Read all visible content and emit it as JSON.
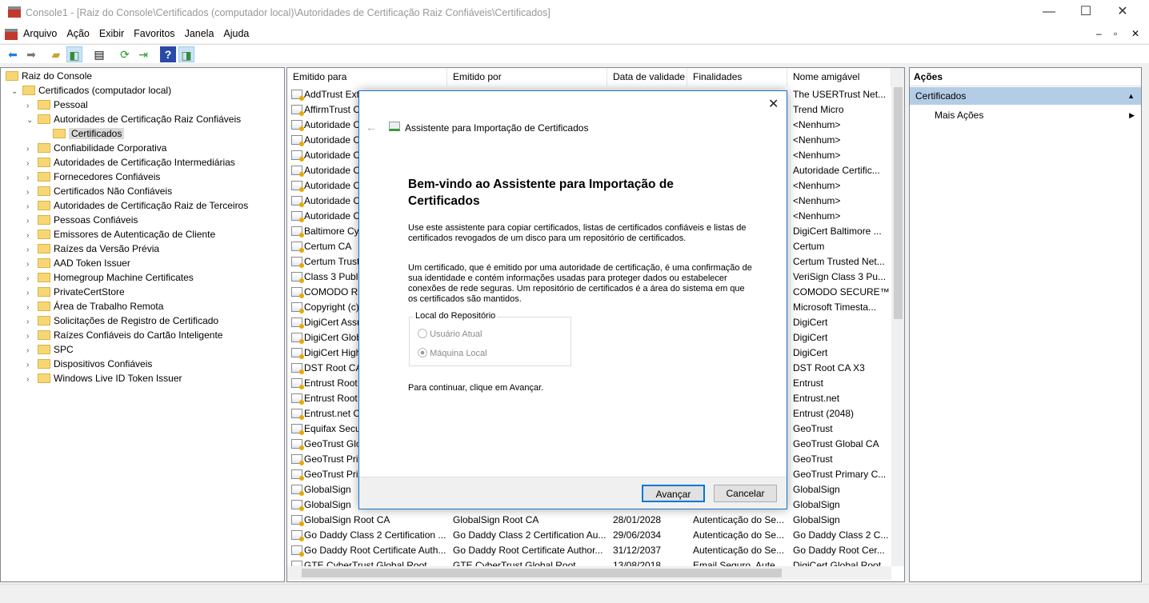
{
  "window": {
    "title": "Console1 - [Raiz do Console\\Certificados (computador local)\\Autoridades de Certificação Raiz Confiáveis\\Certificados]",
    "minimize": "—",
    "maximize": "☐",
    "close": "✕"
  },
  "menu": [
    "Arquivo",
    "Ação",
    "Exibir",
    "Favoritos",
    "Janela",
    "Ajuda"
  ],
  "mdi_controls": [
    "–",
    "▫",
    "✕"
  ],
  "tree": [
    {
      "label": "Raiz do Console",
      "level": 0,
      "chev": ""
    },
    {
      "label": "Certificados (computador local)",
      "level": 1,
      "chev": "⌄"
    },
    {
      "label": "Pessoal",
      "level": 2,
      "chev": "›"
    },
    {
      "label": "Autoridades de Certificação Raiz Confiáveis",
      "level": 2,
      "chev": "⌄"
    },
    {
      "label": "Certificados",
      "level": 3,
      "chev": "",
      "selected": true
    },
    {
      "label": "Confiabilidade Corporativa",
      "level": 2,
      "chev": "›"
    },
    {
      "label": "Autoridades de Certificação Intermediárias",
      "level": 2,
      "chev": "›"
    },
    {
      "label": "Fornecedores Confiáveis",
      "level": 2,
      "chev": "›"
    },
    {
      "label": "Certificados Não Confiáveis",
      "level": 2,
      "chev": "›"
    },
    {
      "label": "Autoridades de Certificação Raiz de Terceiros",
      "level": 2,
      "chev": "›"
    },
    {
      "label": "Pessoas Confiáveis",
      "level": 2,
      "chev": "›"
    },
    {
      "label": "Emissores de Autenticação de Cliente",
      "level": 2,
      "chev": "›"
    },
    {
      "label": "Raízes da Versão Prévia",
      "level": 2,
      "chev": "›"
    },
    {
      "label": "AAD Token Issuer",
      "level": 2,
      "chev": "›"
    },
    {
      "label": "Homegroup Machine Certificates",
      "level": 2,
      "chev": "›"
    },
    {
      "label": "PrivateCertStore",
      "level": 2,
      "chev": "›"
    },
    {
      "label": "Área de Trabalho Remota",
      "level": 2,
      "chev": "›"
    },
    {
      "label": "Solicitações de Registro de Certificado",
      "level": 2,
      "chev": "›"
    },
    {
      "label": "Raízes Confiáveis do Cartão Inteligente",
      "level": 2,
      "chev": "›"
    },
    {
      "label": "SPC",
      "level": 2,
      "chev": "›"
    },
    {
      "label": "Dispositivos Confiáveis",
      "level": 2,
      "chev": "›"
    },
    {
      "label": "Windows Live ID Token Issuer",
      "level": 2,
      "chev": "›"
    }
  ],
  "list": {
    "columns": [
      "Emitido para",
      "Emitido por",
      "Data de validade",
      "Finalidades",
      "Nome amigável"
    ],
    "rows": [
      [
        "AddTrust Ext",
        "",
        "",
        "",
        "The USERTrust Net..."
      ],
      [
        "AffirmTrust C",
        "",
        "",
        "",
        "Trend Micro"
      ],
      [
        "Autoridade C",
        "",
        "",
        "",
        "<Nenhum>"
      ],
      [
        "Autoridade C",
        "",
        "",
        "",
        "<Nenhum>"
      ],
      [
        "Autoridade C",
        "",
        "",
        "",
        "<Nenhum>"
      ],
      [
        "Autoridade C",
        "",
        "",
        "",
        "Autoridade Certific..."
      ],
      [
        "Autoridade C",
        "",
        "",
        "",
        "<Nenhum>"
      ],
      [
        "Autoridade C",
        "",
        "",
        "",
        "<Nenhum>"
      ],
      [
        "Autoridade C",
        "",
        "",
        "",
        "<Nenhum>"
      ],
      [
        "Baltimore Cy",
        "",
        "",
        "",
        "DigiCert Baltimore ..."
      ],
      [
        "Certum CA",
        "",
        "",
        "",
        "Certum"
      ],
      [
        "Certum Trust",
        "",
        "",
        "",
        "Certum Trusted Net..."
      ],
      [
        "Class 3 Publi",
        "",
        "",
        "",
        "VeriSign Class 3 Pu..."
      ],
      [
        "COMODO RS",
        "",
        "",
        "",
        "COMODO SECURE™"
      ],
      [
        "Copyright (c)",
        "",
        "",
        "",
        "Microsoft Timesta..."
      ],
      [
        "DigiCert Assu",
        "",
        "",
        "",
        "DigiCert"
      ],
      [
        "DigiCert Glob",
        "",
        "",
        "",
        "DigiCert"
      ],
      [
        "DigiCert High",
        "",
        "",
        "",
        "DigiCert"
      ],
      [
        "DST Root CA",
        "",
        "",
        "",
        "DST Root CA X3"
      ],
      [
        "Entrust Root",
        "",
        "",
        "",
        "Entrust"
      ],
      [
        "Entrust Root",
        "",
        "",
        "",
        "Entrust.net"
      ],
      [
        "Entrust.net C",
        "",
        "",
        "",
        "Entrust (2048)"
      ],
      [
        "Equifax Secu",
        "",
        "",
        "",
        "GeoTrust"
      ],
      [
        "GeoTrust Glo",
        "",
        "",
        "",
        "GeoTrust Global CA"
      ],
      [
        "GeoTrust Prin",
        "",
        "",
        "",
        "GeoTrust"
      ],
      [
        "GeoTrust Prin",
        "",
        "",
        "",
        "GeoTrust Primary C..."
      ],
      [
        "GlobalSign",
        "",
        "",
        "",
        "GlobalSign"
      ],
      [
        "GlobalSign",
        "",
        "",
        "",
        "GlobalSign"
      ],
      [
        "GlobalSign Root CA",
        "GlobalSign Root CA",
        "28/01/2028",
        "Autenticação do Se...",
        "GlobalSign"
      ],
      [
        "Go Daddy Class 2 Certification ...",
        "Go Daddy Class 2 Certification Au...",
        "29/06/2034",
        "Autenticação do Se...",
        "Go Daddy Class 2 C..."
      ],
      [
        "Go Daddy Root Certificate Auth...",
        "Go Daddy Root Certificate Author...",
        "31/12/2037",
        "Autenticação do Se...",
        "Go Daddy Root Cer..."
      ],
      [
        "GTE CyberTrust Global Root",
        "GTE CyberTrust Global Root",
        "13/08/2018",
        "Email Seguro, Aute...",
        "DigiCert Global Root"
      ]
    ]
  },
  "actions": {
    "header": "Ações",
    "section": "Certificados",
    "item": "Mais Ações"
  },
  "dialog": {
    "title": "Assistente para Importação de Certificados",
    "heading": "Bem-vindo ao Assistente para Importação de Certificados",
    "p1": "Use este assistente para copiar certificados, listas de certificados confiáveis e listas de certificados revogados de um disco para um repositório de certificados.",
    "p2": "Um certificado, que é emitido por uma autoridade de certificação, é uma confirmação de sua identidade e contém informações usadas para proteger dados ou estabelecer conexões de rede seguras. Um repositório de certificados é a área do sistema em que os certificados são mantidos.",
    "group_label": "Local do Repositório",
    "option_user": "Usuário Atual",
    "option_machine": "Máquina Local",
    "selected_option": "Máquina Local",
    "continue": "Para continuar, clique em Avançar.",
    "next": "Avançar",
    "cancel": "Cancelar"
  }
}
